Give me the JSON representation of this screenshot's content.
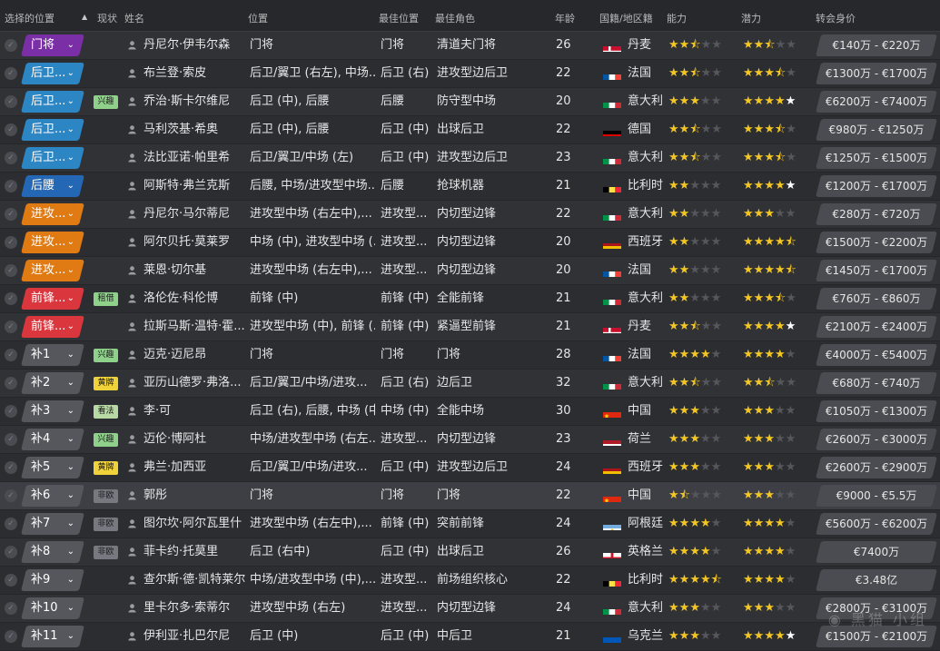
{
  "headers": {
    "selected_position": "选择的位置",
    "status": "现状",
    "name": "姓名",
    "positions": "位置",
    "best_position": "最佳位置",
    "best_role": "最佳角色",
    "age": "年龄",
    "nationality": "国籍/地区籍",
    "ability": "能力",
    "potential": "潜力",
    "transfer_value": "转会身价"
  },
  "colors": {
    "gk": "#7b2fa6",
    "def": "#2d86c4",
    "dm": "#2468b5",
    "mid": "#e07a12",
    "att": "#d9373d",
    "sub": "#55575d",
    "badge_interest": "#8fd18a",
    "badge_yellow": "#f0d23a",
    "badge_view": "#b7d9a3",
    "badge_loan": "#8fd18a",
    "badge_noneu": "#777980"
  },
  "players": [
    {
      "pos_tag": "门将",
      "tag_color": "gk",
      "status": "",
      "name": "丹尼尔·伊韦尔森",
      "positions": "门将",
      "best_pos": "门将",
      "role": "清道夫门将",
      "age": "26",
      "flag": "dk",
      "nat": "丹麦",
      "ability": [
        1,
        1,
        0.5,
        0,
        0
      ],
      "potential": [
        1,
        1,
        0.5,
        0,
        0
      ],
      "value": "€140万 - €220万"
    },
    {
      "pos_tag": "后卫...",
      "tag_color": "def",
      "status": "",
      "name": "布兰登·索皮",
      "positions": "后卫/翼卫 (右左), 中场...",
      "best_pos": "后卫 (右)",
      "role": "进攻型边后卫",
      "age": "22",
      "flag": "fr",
      "nat": "法国",
      "ability": [
        1,
        1,
        0.5,
        0,
        0
      ],
      "potential": [
        1,
        1,
        1,
        0.5,
        0
      ],
      "value": "€1300万 - €1700万"
    },
    {
      "pos_tag": "后卫...",
      "tag_color": "def",
      "status": "兴趣",
      "status_color": "badge_interest",
      "name": "乔治·斯卡尔维尼",
      "positions": "后卫 (中), 后腰",
      "best_pos": "后腰",
      "role": "防守型中场",
      "age": "20",
      "flag": "it",
      "nat": "意大利",
      "ability": [
        1,
        1,
        1,
        0,
        0
      ],
      "potential": [
        1,
        1,
        1,
        1,
        "w"
      ],
      "value": "€6200万 - €7400万"
    },
    {
      "pos_tag": "后卫...",
      "tag_color": "def",
      "status": "",
      "name": "马利茨基·希奥",
      "positions": "后卫 (中), 后腰",
      "best_pos": "后卫 (中)",
      "role": "出球后卫",
      "age": "22",
      "flag": "de",
      "nat": "德国",
      "ability": [
        1,
        1,
        0.5,
        0,
        0
      ],
      "potential": [
        1,
        1,
        1,
        0.5,
        0
      ],
      "value": "€980万 - €1250万"
    },
    {
      "pos_tag": "后卫...",
      "tag_color": "def",
      "status": "",
      "name": "法比亚诺·帕里希",
      "positions": "后卫/翼卫/中场 (左)",
      "best_pos": "后卫 (中)",
      "role": "进攻型边后卫",
      "age": "23",
      "flag": "it",
      "nat": "意大利",
      "ability": [
        1,
        1,
        0.5,
        0,
        0
      ],
      "potential": [
        1,
        1,
        1,
        0.5,
        0
      ],
      "value": "€1250万 - €1500万"
    },
    {
      "pos_tag": "后腰",
      "tag_color": "dm",
      "status": "",
      "name": "阿斯特·弗兰克斯",
      "positions": "后腰, 中场/进攻型中场...",
      "best_pos": "后腰",
      "role": "抢球机器",
      "age": "21",
      "flag": "be",
      "nat": "比利时",
      "ability": [
        1,
        1,
        0,
        0,
        0
      ],
      "potential": [
        1,
        1,
        1,
        1,
        "w"
      ],
      "value": "€1200万 - €1700万"
    },
    {
      "pos_tag": "进攻...",
      "tag_color": "mid",
      "status": "",
      "name": "丹尼尔·马尔蒂尼",
      "positions": "进攻型中场 (右左中),...",
      "best_pos": "进攻型...",
      "role": "内切型边锋",
      "age": "22",
      "flag": "it",
      "nat": "意大利",
      "ability": [
        1,
        1,
        0,
        0,
        0
      ],
      "potential": [
        1,
        1,
        1,
        0,
        0
      ],
      "value": "€280万 - €720万"
    },
    {
      "pos_tag": "进攻...",
      "tag_color": "mid",
      "status": "",
      "name": "阿尔贝托·莫莱罗",
      "positions": "中场 (中), 进攻型中场 (...",
      "best_pos": "进攻型...",
      "role": "内切型边锋",
      "age": "20",
      "flag": "es",
      "nat": "西班牙",
      "ability": [
        1,
        1,
        0,
        0,
        0
      ],
      "potential": [
        1,
        1,
        1,
        1,
        0.5
      ],
      "value": "€1500万 - €2200万"
    },
    {
      "pos_tag": "进攻...",
      "tag_color": "mid",
      "status": "",
      "name": "莱恩·切尔基",
      "positions": "进攻型中场 (右左中),...",
      "best_pos": "进攻型...",
      "role": "内切型边锋",
      "age": "20",
      "flag": "fr",
      "nat": "法国",
      "ability": [
        1,
        1,
        0,
        0,
        0
      ],
      "potential": [
        1,
        1,
        1,
        1,
        0.5
      ],
      "value": "€1450万 - €1700万"
    },
    {
      "pos_tag": "前锋...",
      "tag_color": "att",
      "status": "租借",
      "status_color": "badge_loan",
      "name": "洛伦佐·科伦博",
      "positions": "前锋 (中)",
      "best_pos": "前锋 (中)",
      "role": "全能前锋",
      "age": "21",
      "flag": "it",
      "nat": "意大利",
      "ability": [
        1,
        1,
        0,
        0,
        0
      ],
      "potential": [
        1,
        1,
        1,
        0.5,
        0
      ],
      "value": "€760万 - €860万"
    },
    {
      "pos_tag": "前锋...",
      "tag_color": "att",
      "status": "",
      "name": "拉斯马斯·温特·霍...",
      "positions": "进攻型中场 (中), 前锋 (...",
      "best_pos": "前锋 (中)",
      "role": "紧逼型前锋",
      "age": "21",
      "flag": "dk",
      "nat": "丹麦",
      "ability": [
        1,
        1,
        0.5,
        0,
        0
      ],
      "potential": [
        1,
        1,
        1,
        1,
        "w"
      ],
      "value": "€2100万 - €2400万"
    },
    {
      "pos_tag": "补1",
      "tag_color": "sub",
      "status": "兴趣",
      "status_color": "badge_interest",
      "name": "迈克·迈尼昂",
      "positions": "门将",
      "best_pos": "门将",
      "role": "门将",
      "age": "28",
      "flag": "fr",
      "nat": "法国",
      "ability": [
        1,
        1,
        1,
        1,
        0
      ],
      "potential": [
        1,
        1,
        1,
        1,
        0
      ],
      "value": "€4000万 - €5400万"
    },
    {
      "pos_tag": "补2",
      "tag_color": "sub",
      "status": "黄牌",
      "status_color": "badge_yellow",
      "name": "亚历山德罗·弗洛...",
      "positions": "后卫/翼卫/中场/进攻...",
      "best_pos": "后卫 (右)",
      "role": "边后卫",
      "age": "32",
      "flag": "it",
      "nat": "意大利",
      "ability": [
        1,
        1,
        0.5,
        0,
        0
      ],
      "potential": [
        1,
        1,
        0.5,
        0,
        0
      ],
      "value": "€680万 - €740万"
    },
    {
      "pos_tag": "补3",
      "tag_color": "sub",
      "status": "看法",
      "status_color": "badge_view",
      "name": "李·可",
      "positions": "后卫 (右), 后腰, 中场 (中)",
      "best_pos": "中场 (中)",
      "role": "全能中场",
      "age": "30",
      "flag": "cn",
      "nat": "中国",
      "ability": [
        1,
        1,
        1,
        0,
        0
      ],
      "potential": [
        1,
        1,
        1,
        0,
        0
      ],
      "value": "€1050万 - €1300万"
    },
    {
      "pos_tag": "补4",
      "tag_color": "sub",
      "status": "兴趣",
      "status_color": "badge_interest",
      "name": "迈伦·博阿杜",
      "positions": "中场/进攻型中场 (右左...",
      "best_pos": "进攻型...",
      "role": "内切型边锋",
      "age": "23",
      "flag": "nl",
      "nat": "荷兰",
      "ability": [
        1,
        1,
        1,
        0,
        0
      ],
      "potential": [
        1,
        1,
        1,
        0,
        0
      ],
      "value": "€2600万 - €3000万"
    },
    {
      "pos_tag": "补5",
      "tag_color": "sub",
      "status": "黄牌",
      "status_color": "badge_yellow",
      "name": "弗兰·加西亚",
      "positions": "后卫/翼卫/中场/进攻...",
      "best_pos": "后卫 (中)",
      "role": "进攻型边后卫",
      "age": "24",
      "flag": "es",
      "nat": "西班牙",
      "ability": [
        1,
        1,
        1,
        0,
        0
      ],
      "potential": [
        1,
        1,
        1,
        0,
        0
      ],
      "value": "€2600万 - €2900万"
    },
    {
      "pos_tag": "补6",
      "tag_color": "sub",
      "status": "非欧",
      "status_color": "badge_noneu",
      "name": "郭彤",
      "positions": "门将",
      "best_pos": "门将",
      "role": "门将",
      "age": "22",
      "flag": "cn",
      "nat": "中国",
      "ability": [
        1,
        0.5,
        0,
        0,
        0
      ],
      "potential": [
        1,
        1,
        1,
        0,
        0
      ],
      "value": "€9000 - €5.5万",
      "highlight": true
    },
    {
      "pos_tag": "补7",
      "tag_color": "sub",
      "status": "非欧",
      "status_color": "badge_noneu",
      "name": "图尔坎·阿尔瓦里什",
      "positions": "进攻型中场 (右左中),...",
      "best_pos": "前锋 (中)",
      "role": "突前前锋",
      "age": "24",
      "flag": "ar",
      "nat": "阿根廷",
      "ability": [
        1,
        1,
        1,
        1,
        0
      ],
      "potential": [
        1,
        1,
        1,
        1,
        0
      ],
      "value": "€5600万 - €6200万"
    },
    {
      "pos_tag": "补8",
      "tag_color": "sub",
      "status": "非欧",
      "status_color": "badge_noneu",
      "name": "菲卡约·托莫里",
      "positions": "后卫 (右中)",
      "best_pos": "后卫 (中)",
      "role": "出球后卫",
      "age": "26",
      "flag": "en",
      "nat": "英格兰",
      "ability": [
        1,
        1,
        1,
        1,
        0
      ],
      "potential": [
        1,
        1,
        1,
        1,
        0
      ],
      "value": "€7400万"
    },
    {
      "pos_tag": "补9",
      "tag_color": "sub",
      "status": "",
      "name": "查尔斯·德·凯特莱尔",
      "positions": "中场/进攻型中场 (中),...",
      "best_pos": "进攻型...",
      "role": "前场组织核心",
      "age": "22",
      "flag": "be",
      "nat": "比利时",
      "ability": [
        1,
        1,
        1,
        1,
        0.5
      ],
      "potential": [
        1,
        1,
        1,
        1,
        0
      ],
      "value": "€3.48亿"
    },
    {
      "pos_tag": "补10",
      "tag_color": "sub",
      "status": "",
      "name": "里卡尔多·索蒂尔",
      "positions": "进攻型中场 (右左)",
      "best_pos": "进攻型...",
      "role": "内切型边锋",
      "age": "24",
      "flag": "it",
      "nat": "意大利",
      "ability": [
        1,
        1,
        1,
        0,
        0
      ],
      "potential": [
        1,
        1,
        1,
        0,
        0
      ],
      "value": "€2800万 - €3100万"
    },
    {
      "pos_tag": "补11",
      "tag_color": "sub",
      "status": "",
      "name": "伊利亚·扎巴尔尼",
      "positions": "后卫 (中)",
      "best_pos": "后卫 (中)",
      "role": "中后卫",
      "age": "21",
      "flag": "ua",
      "nat": "乌克兰",
      "ability": [
        1,
        1,
        1,
        0,
        0
      ],
      "potential": [
        1,
        1,
        1,
        1,
        "w"
      ],
      "value": "€1500万 - €2100万"
    }
  ]
}
